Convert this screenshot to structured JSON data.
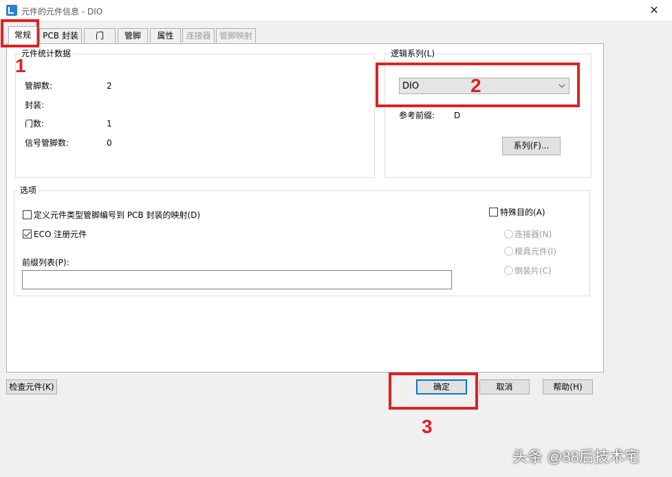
{
  "window": {
    "title": "元件的元件信息 - DIO"
  },
  "tabs": [
    {
      "label": "常规",
      "active": true,
      "enabled": true
    },
    {
      "label": "PCB 封装",
      "enabled": true
    },
    {
      "label": "门",
      "enabled": true
    },
    {
      "label": "管脚",
      "enabled": true
    },
    {
      "label": "属性",
      "enabled": true
    },
    {
      "label": "连接器",
      "enabled": false
    },
    {
      "label": "管脚映射",
      "enabled": false
    }
  ],
  "stats": {
    "title": "元件统计数据",
    "rows": [
      {
        "label": "管脚数:",
        "value": "2"
      },
      {
        "label": "封装:",
        "value": ""
      },
      {
        "label": "门数:",
        "value": "1"
      },
      {
        "label": "信号管脚数:",
        "value": "0"
      }
    ]
  },
  "logic_family": {
    "title": "逻辑系列(L)",
    "selected": "DIO",
    "ref_prefix_label": "参考前缀:",
    "ref_prefix_value": "D",
    "family_button": "系列(F)..."
  },
  "options": {
    "title": "选项",
    "define_mapping": {
      "label": "定义元件类型管脚编号到 PCB 封装的映射(D)",
      "checked": false
    },
    "eco_register": {
      "label": "ECO 注册元件",
      "checked": true
    },
    "prefix_list_label": "前缀列表(P):",
    "prefix_list_value": "",
    "special_purpose": {
      "label": "特殊目的(A)",
      "checked": false
    },
    "radios": [
      "连接器(N)",
      "模具元件(I)",
      "倒装片(C)"
    ]
  },
  "footer": {
    "check_part": "检查元件(K)",
    "ok": "确定",
    "cancel": "取消",
    "help": "帮助(H)"
  },
  "annotations": {
    "n1": "1",
    "n2": "2",
    "n3": "3",
    "color": "#e02020"
  },
  "watermark": "头条 @88后技术宅"
}
